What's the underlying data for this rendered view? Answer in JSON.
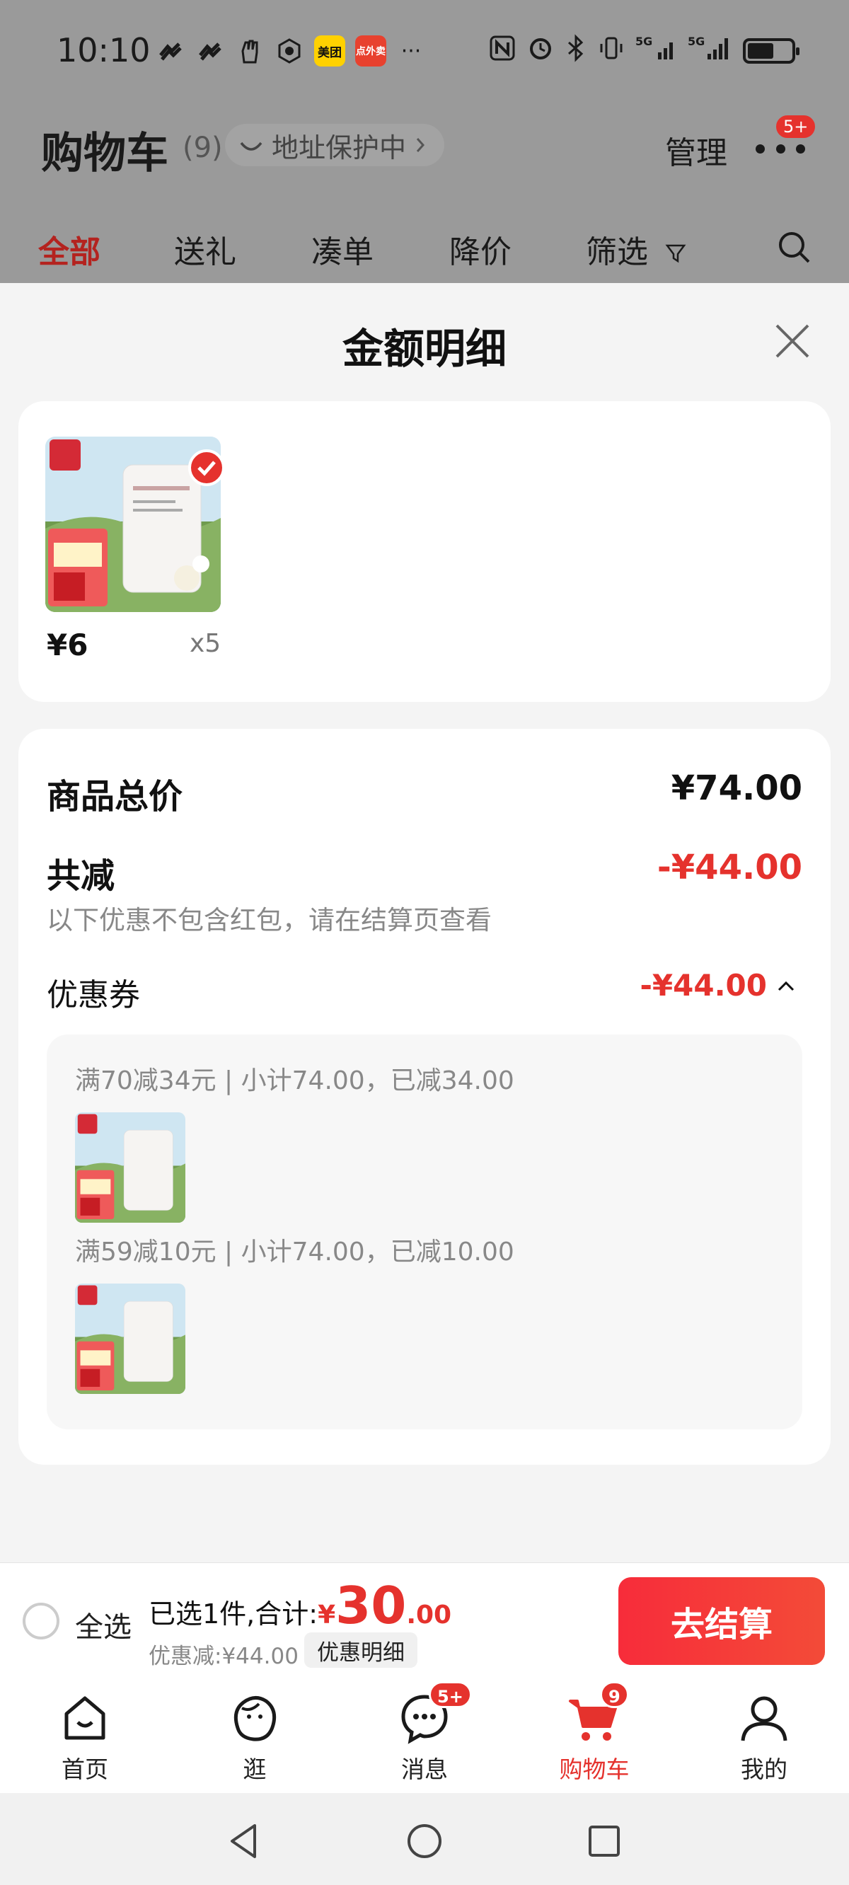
{
  "status_bar": {
    "time": "10:10",
    "app_icons": [
      "meituan-icon",
      "eleme-icon"
    ],
    "meituan_label": "美团",
    "eleme_label": "点外卖",
    "more": "···"
  },
  "header": {
    "title": "购物车",
    "count": "(9)",
    "address_badge": "地址保护中",
    "manage": "管理",
    "more_badge": "5+"
  },
  "tabs": [
    {
      "label": "全部",
      "active": true
    },
    {
      "label": "送礼"
    },
    {
      "label": "凑单"
    },
    {
      "label": "降价"
    },
    {
      "label": "筛选"
    }
  ],
  "sheet": {
    "title": "金额明细",
    "item": {
      "price": "¥6",
      "qty": "x5"
    },
    "summary": {
      "total_label": "商品总价",
      "total_value": "¥74.00",
      "discount_label": "共减",
      "discount_value": "-¥44.00",
      "note": "以下优惠不包含红包，请在结算页查看",
      "coupon_label": "优惠券",
      "coupon_value": "-¥44.00"
    },
    "coupons": [
      {
        "text": "满70减34元 | 小计74.00，已减34.00"
      },
      {
        "text": "满59减10元 | 小计74.00，已减10.00"
      }
    ]
  },
  "checkout": {
    "select_all": "全选",
    "selected_text": "已选1件,合计:",
    "currency": "¥",
    "amount_int": "30",
    "amount_dec": ".00",
    "discount_text": "优惠减:¥44.00",
    "detail_button": "优惠明细",
    "pay_button": "去结算"
  },
  "tabbar": [
    {
      "label": "首页",
      "icon": "home-icon"
    },
    {
      "label": "逛",
      "icon": "explore-icon"
    },
    {
      "label": "消息",
      "icon": "message-icon",
      "badge": "5+"
    },
    {
      "label": "购物车",
      "icon": "cart-icon",
      "badge": "9",
      "active": true
    },
    {
      "label": "我的",
      "icon": "profile-icon"
    }
  ],
  "colors": {
    "accent": "#e5322d",
    "dim_overlay": "#9a9a9a"
  }
}
